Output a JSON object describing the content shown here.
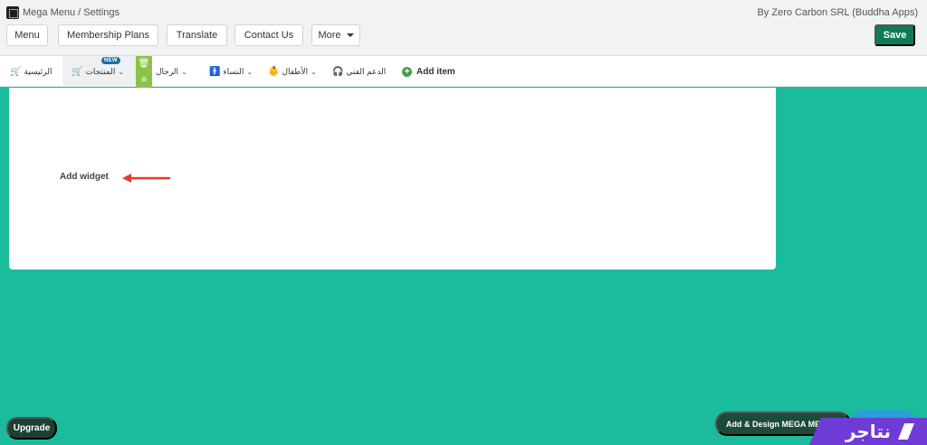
{
  "app": {
    "title": "Mega Menu / Settings",
    "vendor": "By Zero Carbon SRL (Buddha Apps)"
  },
  "toolbar": {
    "menu_label": "Menu",
    "membership_label": "Membership Plans",
    "translate_label": "Translate",
    "contact_label": "Contact Us",
    "more_label": "More",
    "save_label": "Save"
  },
  "menubar": {
    "items": [
      {
        "label": "الرئيسية",
        "icon": "cart-icon"
      },
      {
        "label": "المنتجات",
        "icon": "cart-icon",
        "badge": "NEW"
      },
      {
        "label": "الرجال",
        "icon": "none"
      },
      {
        "label": "النساء",
        "icon": "person-icon"
      },
      {
        "label": "الأطفال",
        "icon": "child-icon"
      },
      {
        "label": "الدعم الفني",
        "icon": "headset-icon"
      }
    ],
    "add_item_label": "Add item"
  },
  "panel": {
    "add_widget_label": "Add widget"
  },
  "footer": {
    "upgrade_label": "Upgrade",
    "mega_label": "Add & Design MEGA MENU",
    "brand_text": "نتاجر"
  },
  "colors": {
    "background": "#1bbc9b",
    "save": "#0e7c55",
    "handle": "#8bc34a",
    "badge": "#1d6fa5",
    "arrow": "#e53935",
    "brand": "#6f3bd5"
  }
}
